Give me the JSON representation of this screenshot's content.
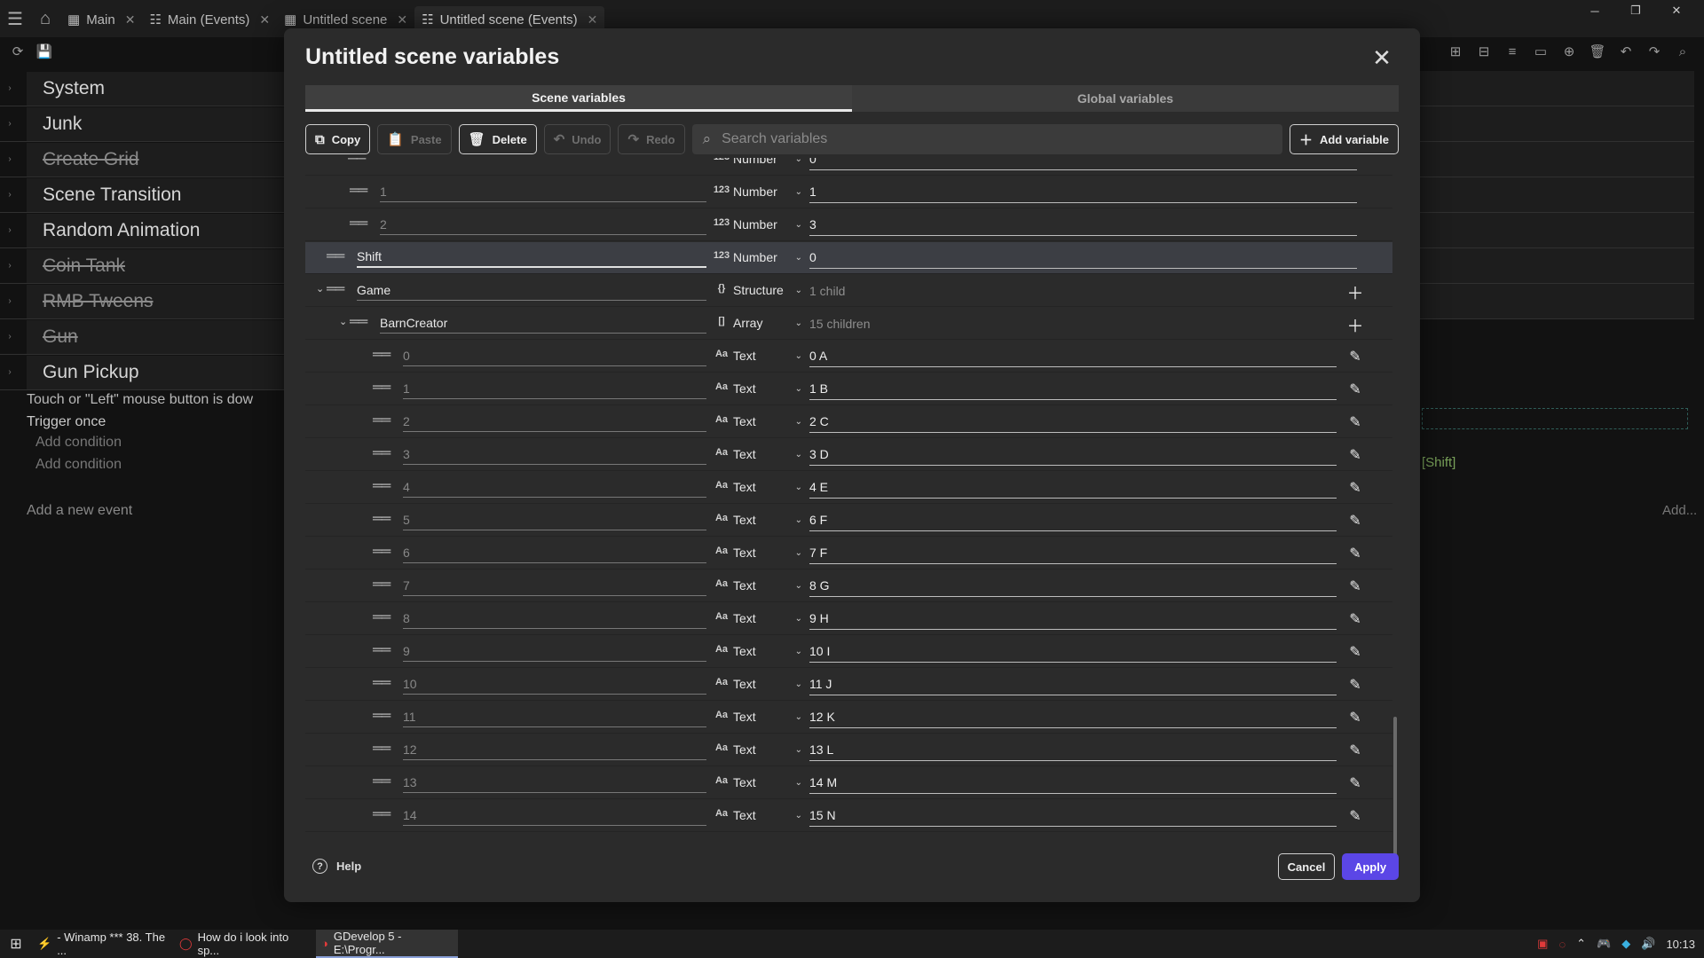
{
  "tabbar": {
    "tabs": [
      {
        "label": "Main",
        "icon": "scene-icon"
      },
      {
        "label": "Main (Events)",
        "icon": "events-icon"
      },
      {
        "label": "Untitled scene",
        "icon": "scene-icon"
      },
      {
        "label": "Untitled scene (Events)",
        "icon": "events-icon"
      }
    ]
  },
  "events": {
    "rows": [
      {
        "label": "System",
        "strike": false
      },
      {
        "label": "Junk",
        "strike": false
      },
      {
        "label": "Create Grid",
        "strike": true
      },
      {
        "label": "Scene Transition",
        "strike": false
      },
      {
        "label": "Random Animation",
        "strike": false
      },
      {
        "label": "Coin Tank",
        "strike": true
      },
      {
        "label": "RMB Tweens",
        "strike": true
      },
      {
        "label": "Gun",
        "strike": true
      },
      {
        "label": "Gun Pickup",
        "strike": false
      }
    ],
    "condition_1": "Touch or \"Left\" mouse button is dow",
    "condition_2": "Trigger once",
    "add_condition": "Add condition",
    "add_condition_2": "Add condition",
    "add_event": "Add a new event",
    "shift_ref": "[Shift]",
    "add_right": "Add..."
  },
  "dialog": {
    "title": "Untitled scene variables",
    "tabs": {
      "scene": "Scene variables",
      "global": "Global variables"
    },
    "actions": {
      "copy": "Copy",
      "paste": "Paste",
      "delete": "Delete",
      "undo": "Undo",
      "redo": "Redo",
      "add": "Add variable"
    },
    "search_placeholder": "Search variables",
    "rows": [
      {
        "indent": 1,
        "name": "1",
        "typeIcon": "123",
        "type": "Number",
        "value": "1",
        "nameStyle": "muted"
      },
      {
        "indent": 1,
        "name": "2",
        "typeIcon": "123",
        "type": "Number",
        "value": "3",
        "nameStyle": "muted"
      },
      {
        "indent": 0,
        "name": "Shift",
        "typeIcon": "123",
        "type": "Number",
        "value": "0",
        "nameStyle": "edit",
        "selected": true
      },
      {
        "indent": 0,
        "name": "Game",
        "typeIcon": "{}",
        "type": "Structure",
        "value": "1 child",
        "valueStyle": "muted",
        "caret": true,
        "action": "add",
        "nameStyle": "dark"
      },
      {
        "indent": 1,
        "name": "BarnCreator",
        "typeIcon": "[]",
        "type": "Array",
        "value": "15 children",
        "valueStyle": "muted",
        "caret": true,
        "action": "add",
        "nameStyle": "dark"
      },
      {
        "indent": 2,
        "name": "0",
        "typeIcon": "Aa",
        "type": "Text",
        "value": "0 A",
        "action": "edit",
        "nameStyle": "muted"
      },
      {
        "indent": 2,
        "name": "1",
        "typeIcon": "Aa",
        "type": "Text",
        "value": "1 B",
        "action": "edit",
        "nameStyle": "muted"
      },
      {
        "indent": 2,
        "name": "2",
        "typeIcon": "Aa",
        "type": "Text",
        "value": "2 C",
        "action": "edit",
        "nameStyle": "muted"
      },
      {
        "indent": 2,
        "name": "3",
        "typeIcon": "Aa",
        "type": "Text",
        "value": "3 D",
        "action": "edit",
        "nameStyle": "muted"
      },
      {
        "indent": 2,
        "name": "4",
        "typeIcon": "Aa",
        "type": "Text",
        "value": "4 E",
        "action": "edit",
        "nameStyle": "muted"
      },
      {
        "indent": 2,
        "name": "5",
        "typeIcon": "Aa",
        "type": "Text",
        "value": "6 F",
        "action": "edit",
        "nameStyle": "muted"
      },
      {
        "indent": 2,
        "name": "6",
        "typeIcon": "Aa",
        "type": "Text",
        "value": "7 F",
        "action": "edit",
        "nameStyle": "muted"
      },
      {
        "indent": 2,
        "name": "7",
        "typeIcon": "Aa",
        "type": "Text",
        "value": "8 G",
        "action": "edit",
        "nameStyle": "muted"
      },
      {
        "indent": 2,
        "name": "8",
        "typeIcon": "Aa",
        "type": "Text",
        "value": "9 H",
        "action": "edit",
        "nameStyle": "muted"
      },
      {
        "indent": 2,
        "name": "9",
        "typeIcon": "Aa",
        "type": "Text",
        "value": "10 I",
        "action": "edit",
        "nameStyle": "muted"
      },
      {
        "indent": 2,
        "name": "10",
        "typeIcon": "Aa",
        "type": "Text",
        "value": "11 J",
        "action": "edit",
        "nameStyle": "muted"
      },
      {
        "indent": 2,
        "name": "11",
        "typeIcon": "Aa",
        "type": "Text",
        "value": "12 K",
        "action": "edit",
        "nameStyle": "muted"
      },
      {
        "indent": 2,
        "name": "12",
        "typeIcon": "Aa",
        "type": "Text",
        "value": "13 L",
        "action": "edit",
        "nameStyle": "muted"
      },
      {
        "indent": 2,
        "name": "13",
        "typeIcon": "Aa",
        "type": "Text",
        "value": "14 M",
        "action": "edit",
        "nameStyle": "muted"
      },
      {
        "indent": 2,
        "name": "14",
        "typeIcon": "Aa",
        "type": "Text",
        "value": "15 N",
        "action": "edit",
        "nameStyle": "muted"
      }
    ],
    "help": "Help",
    "cancel": "Cancel",
    "apply": "Apply",
    "accent_color": "#5b46e6"
  },
  "taskbar": {
    "tasks": [
      {
        "label": "- Winamp *** 38. The ...",
        "icon": "winamp-icon"
      },
      {
        "label": "How do i look into sp...",
        "icon": "opera-icon"
      },
      {
        "label": "GDevelop 5 - E:\\Progr...",
        "icon": "gdevelop-icon"
      }
    ],
    "clock": "10:13"
  }
}
